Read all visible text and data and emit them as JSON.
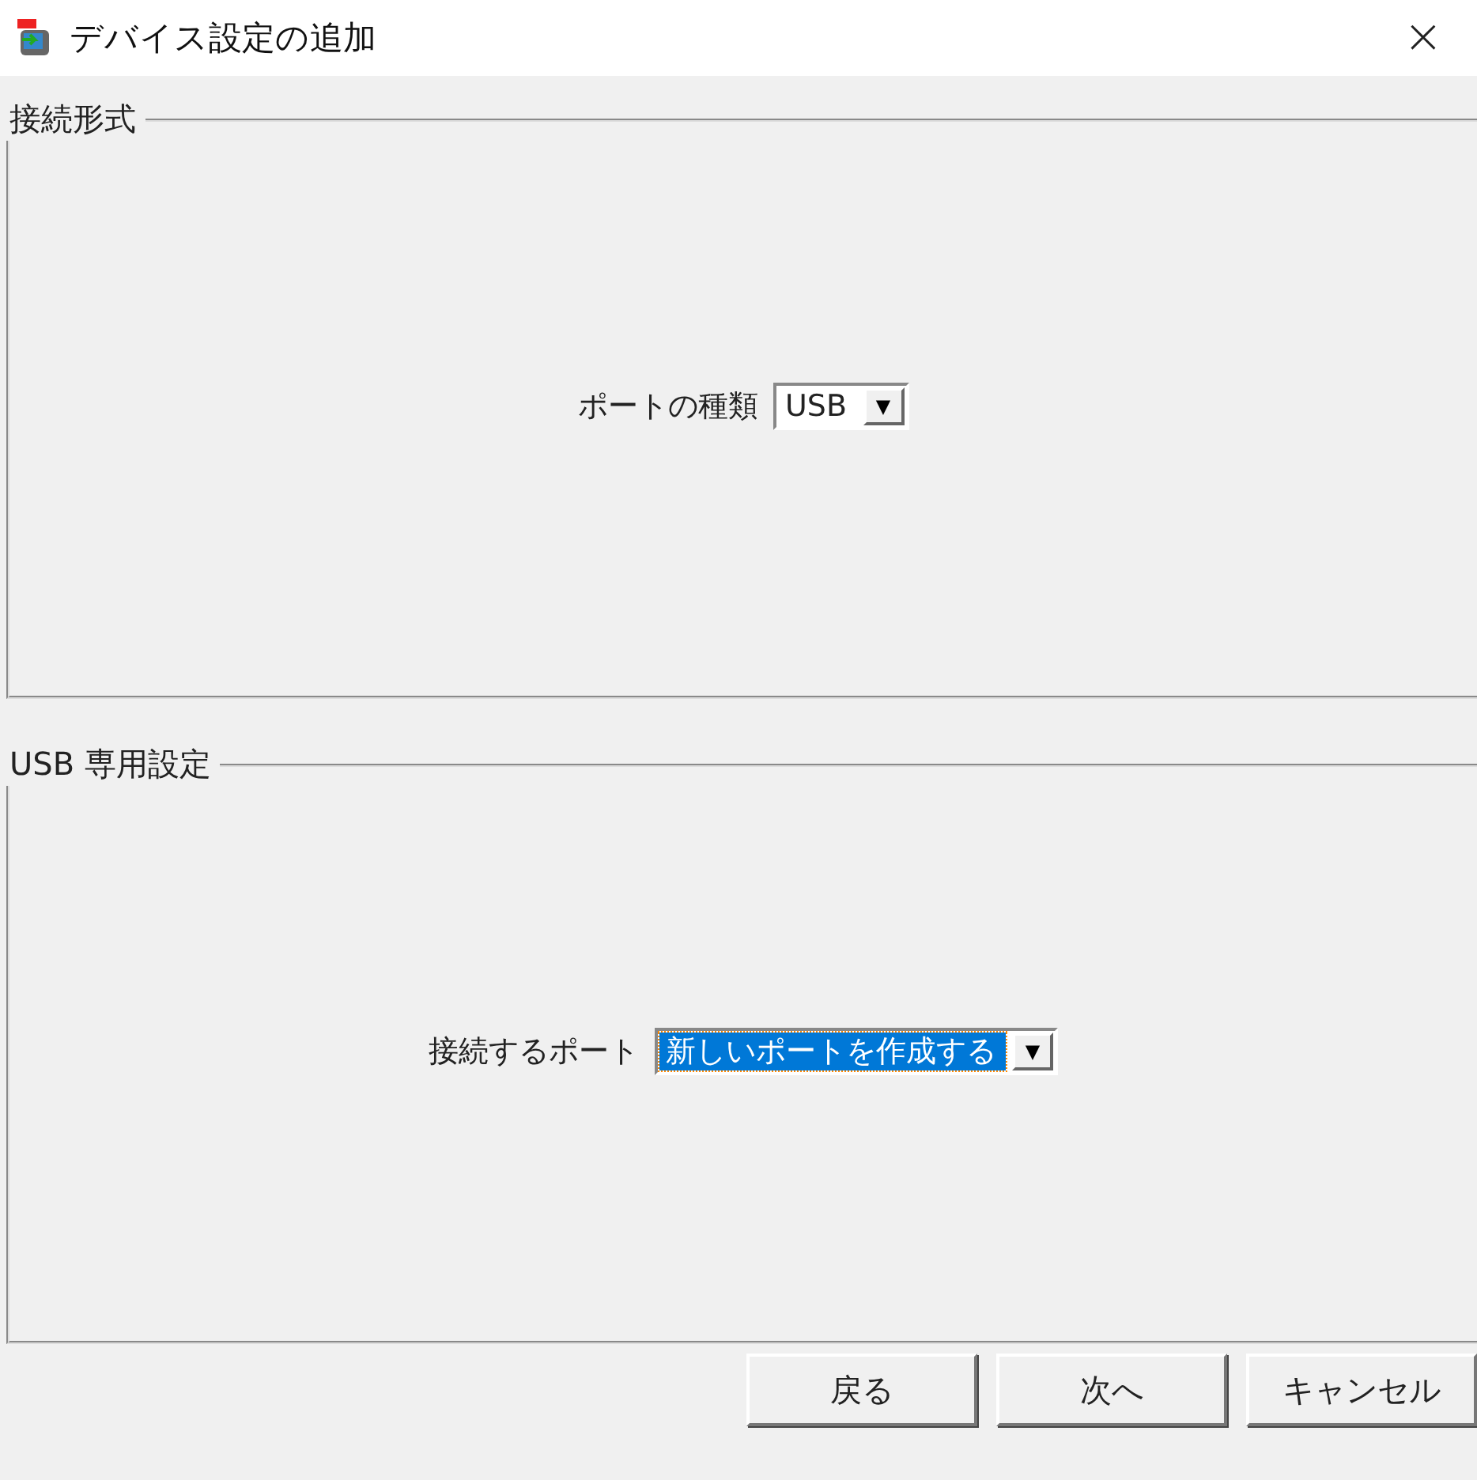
{
  "window": {
    "title": "デバイス設定の追加",
    "close": "×"
  },
  "groups": [
    {
      "title": "接続形式",
      "field": {
        "label": "ポートの種類",
        "value": "USB",
        "focused": false,
        "arrow": "▼"
      }
    },
    {
      "title": "USB 専用設定",
      "field": {
        "label": "接続するポート",
        "value": "新しいポートを作成する",
        "focused": true,
        "arrow": "▼"
      }
    }
  ],
  "buttons": [
    "戻る",
    "次へ",
    "キャンセル"
  ]
}
